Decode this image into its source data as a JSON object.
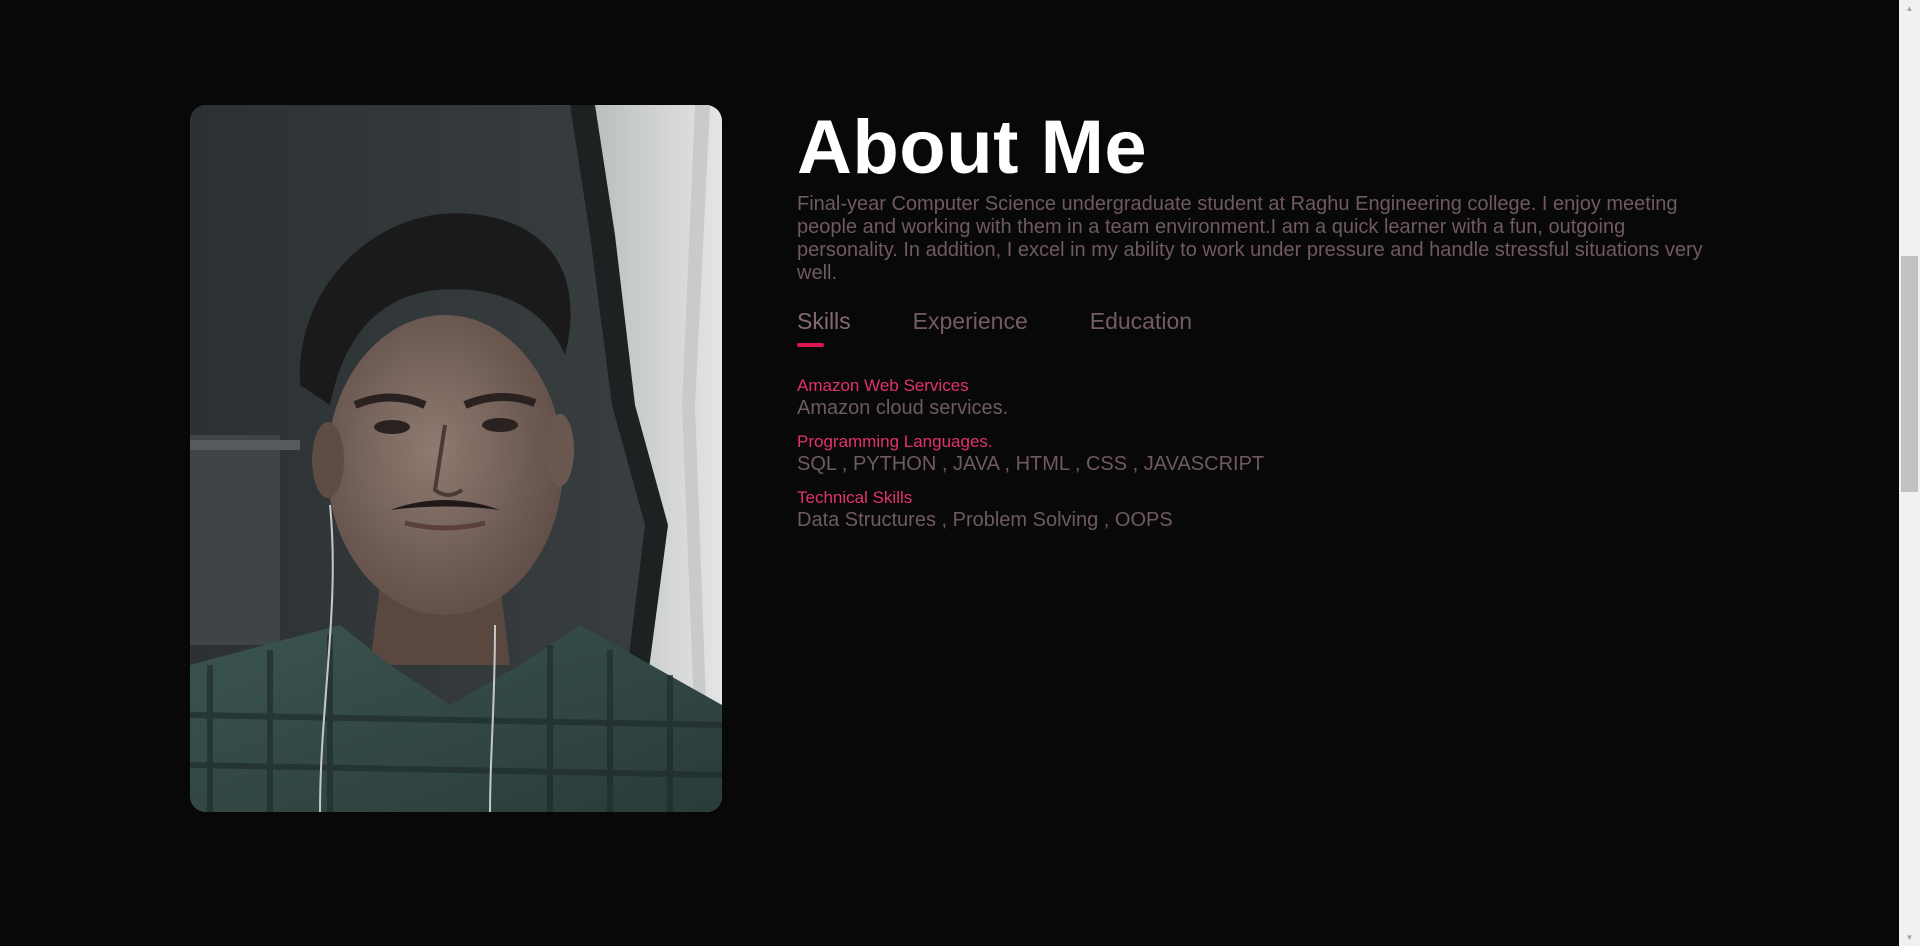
{
  "about": {
    "title": "About Me",
    "intro": "Final-year Computer Science undergraduate student at Raghu Engineering college. I enjoy meeting people and working with them in a team environment.I am a quick learner with a fun, outgoing personality. In addition, I excel in my ability to work under pressure and handle stressful situations very well."
  },
  "tabs": [
    {
      "label": "Skills",
      "active": true
    },
    {
      "label": "Experience",
      "active": false
    },
    {
      "label": "Education",
      "active": false
    }
  ],
  "skills": [
    {
      "name": "Amazon Web Services",
      "desc": "Amazon cloud services."
    },
    {
      "name": "Programming Languages.",
      "desc": "SQL , PYTHON , JAVA , HTML , CSS , JAVASCRIPT"
    },
    {
      "name": "Technical Skills",
      "desc": "Data Structures , Problem Solving , OOPS"
    }
  ],
  "colors": {
    "background": "#080808",
    "accent": "#e0154f",
    "skill_title": "#e2326d",
    "muted_text": "#6f5a5e"
  },
  "icons": {
    "scroll_up": "triangle-up-icon",
    "scroll_down": "triangle-down-icon"
  }
}
